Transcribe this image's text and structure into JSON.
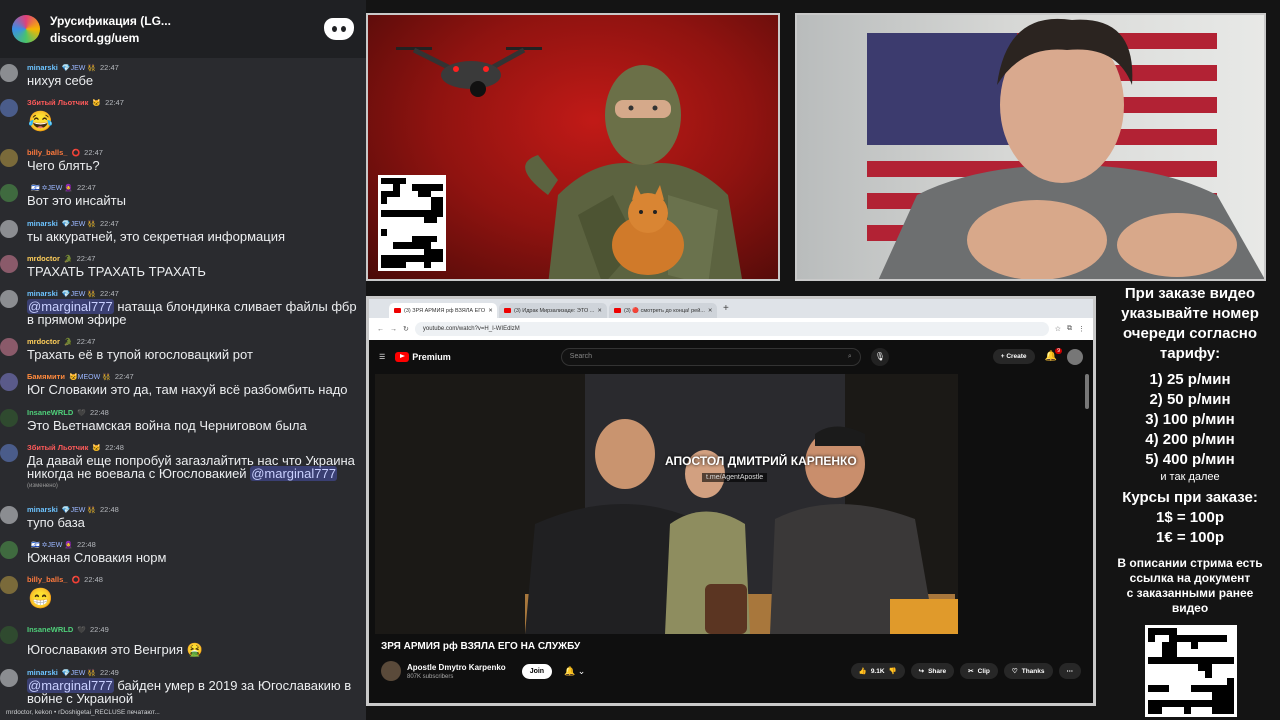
{
  "server": {
    "name": "Урусификация (LG...",
    "invite": "discord.gg/uem"
  },
  "messages": [
    {
      "user": "minarski",
      "badges": "💎JEW 👯",
      "time": "22:47",
      "text": "нихуя себе",
      "color": "#6cc3ff"
    },
    {
      "user": "Збитый Льотчик",
      "badges": "🐱",
      "time": "22:47",
      "text": "😂",
      "color": "#ff5a5a"
    },
    {
      "user": "billy_balls_",
      "badges": "⭕",
      "time": "22:47",
      "text": "Чего блять?",
      "color": "#ff7a3d"
    },
    {
      "user": "",
      "badges": "🇮🇱 ✡JEW 🧕",
      "time": "22:47",
      "text": "Вот это инсайты",
      "color": "#ffffff"
    },
    {
      "user": "minarski",
      "badges": "💎JEW 👯",
      "time": "22:47",
      "text": "ты аккуратней, это секретная информация",
      "color": "#6cc3ff"
    },
    {
      "user": "mrdoctor",
      "badges": "🐊",
      "time": "22:47",
      "text": "ТРАХАТЬ ТРАХАТЬ ТРАХАТЬ",
      "color": "#ffcf5a"
    },
    {
      "user": "minarski",
      "badges": "💎JEW 👯",
      "time": "22:47",
      "mention": "@marginal777",
      "text": "натаща блондинка сливает файлы фбр в прямом эфире",
      "color": "#6cc3ff"
    },
    {
      "user": "mrdoctor",
      "badges": "🐊",
      "time": "22:47",
      "text": "Трахать её в тупой югословацкий рот",
      "color": "#ffcf5a"
    },
    {
      "user": "Бамямити",
      "badges": "😺MEOW 👯",
      "time": "22:47",
      "text": "Юг Словакии это да, там нахуй всё разбомбить надо",
      "color": "#ff8a3d"
    },
    {
      "user": "InsaneWRLD",
      "badges": "🖤",
      "time": "22:48",
      "text": "Это Вьетнамская война под Черниговом была",
      "color": "#4fd07a"
    },
    {
      "user": "Збитый Льотчик",
      "badges": "🐱",
      "time": "22:48",
      "text": "Да давай еще попробуй загазлайтить нас что Украина никогда не воевала с Югословакией",
      "mention_after": "@marginal777",
      "edited": "(изменено)",
      "color": "#ff5a5a"
    },
    {
      "user": "minarski",
      "badges": "💎JEW 👯",
      "time": "22:48",
      "text": "тупо база",
      "color": "#6cc3ff"
    },
    {
      "user": "",
      "badges": "🇮🇱 ✡JEW 🧕",
      "time": "22:48",
      "text": "Южная Словакия норм",
      "color": "#ffffff"
    },
    {
      "user": "billy_balls_",
      "badges": "⭕",
      "time": "22:48",
      "text": "😁",
      "color": "#ff7a3d"
    },
    {
      "user": "InsaneWRLD",
      "badges": "🖤",
      "time": "22:49",
      "text": "Югославакия это Венгрия 🤮",
      "color": "#4fd07a"
    },
    {
      "user": "minarski",
      "badges": "💎JEW 👯",
      "time": "22:49",
      "mention": "@marginal777",
      "text": "байден умер в 2019 за Югославакию в войне с Украиной",
      "color": "#6cc3ff"
    }
  ],
  "typing": "mrdoctor, kekon • rDoshigetai_RECLUSE печатают...",
  "browser": {
    "tabs": [
      "(3) ЗРЯ АРМИЯ рф ВЗЯЛА ЕГО",
      "(3) Идрак Мирзализаде: ЭТО ...",
      "(3) 🔴 смотреть до конца! рей..."
    ],
    "url": "youtube.com/watch?v=H_I-WIEdlzM",
    "premium": "Premium",
    "search_placeholder": "Search",
    "create": "Create",
    "notif_count": "9",
    "video_overlay_title": "АПОСТОЛ ДМИТРИЙ КАРПЕНКО",
    "video_overlay_tg": "t.me/AgentApostle",
    "video_title": "ЗРЯ АРМИЯ рф ВЗЯЛА ЕГО НА СЛУЖБУ",
    "channel": "Apostle Dmytro Karpenko",
    "subs": "807K subscribers",
    "join": "Join",
    "likes": "9.1K",
    "share": "Share",
    "clip": "Clip",
    "thanks": "Thanks"
  },
  "info": {
    "line1": "При заказе видео",
    "line2": "указывайте номер",
    "line3": "очереди согласно",
    "line4": "тарифу:",
    "rates": [
      "1) 25 р/мин",
      "2) 50 р/мин",
      "3) 100 р/мин",
      "4) 200 р/мин",
      "5) 400 р/мин"
    ],
    "etc": "и так далее",
    "courses": "Курсы при заказе:",
    "usd": "1$ = 100р",
    "eur": "1€ = 100р",
    "note1": "В описании стрима есть",
    "note2": "ссылка на документ",
    "note3": "с заказанными ранее",
    "note4": "видео"
  }
}
